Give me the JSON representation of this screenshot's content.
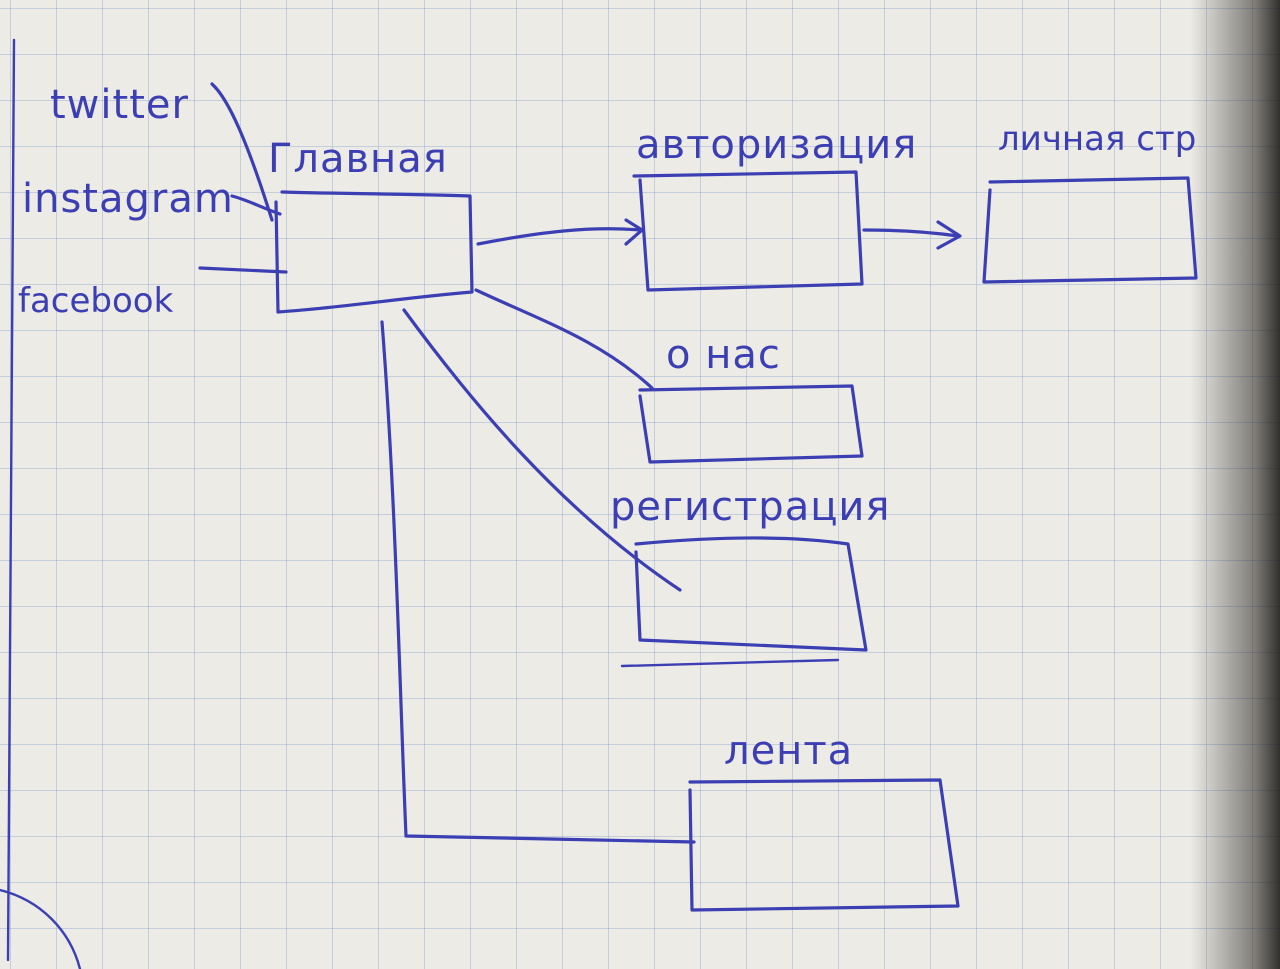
{
  "social": {
    "twitter": "twitter",
    "instagram": "instagram",
    "facebook": "facebook"
  },
  "pages": {
    "main": "Главная",
    "auth": "авторизация",
    "personal": "личная стр",
    "about": "о нас",
    "registration": "регистрация",
    "feed": "лента"
  },
  "colors": {
    "ink": "#3b3fb3",
    "paper": "#ecebe6",
    "grid": "#7896c8"
  }
}
